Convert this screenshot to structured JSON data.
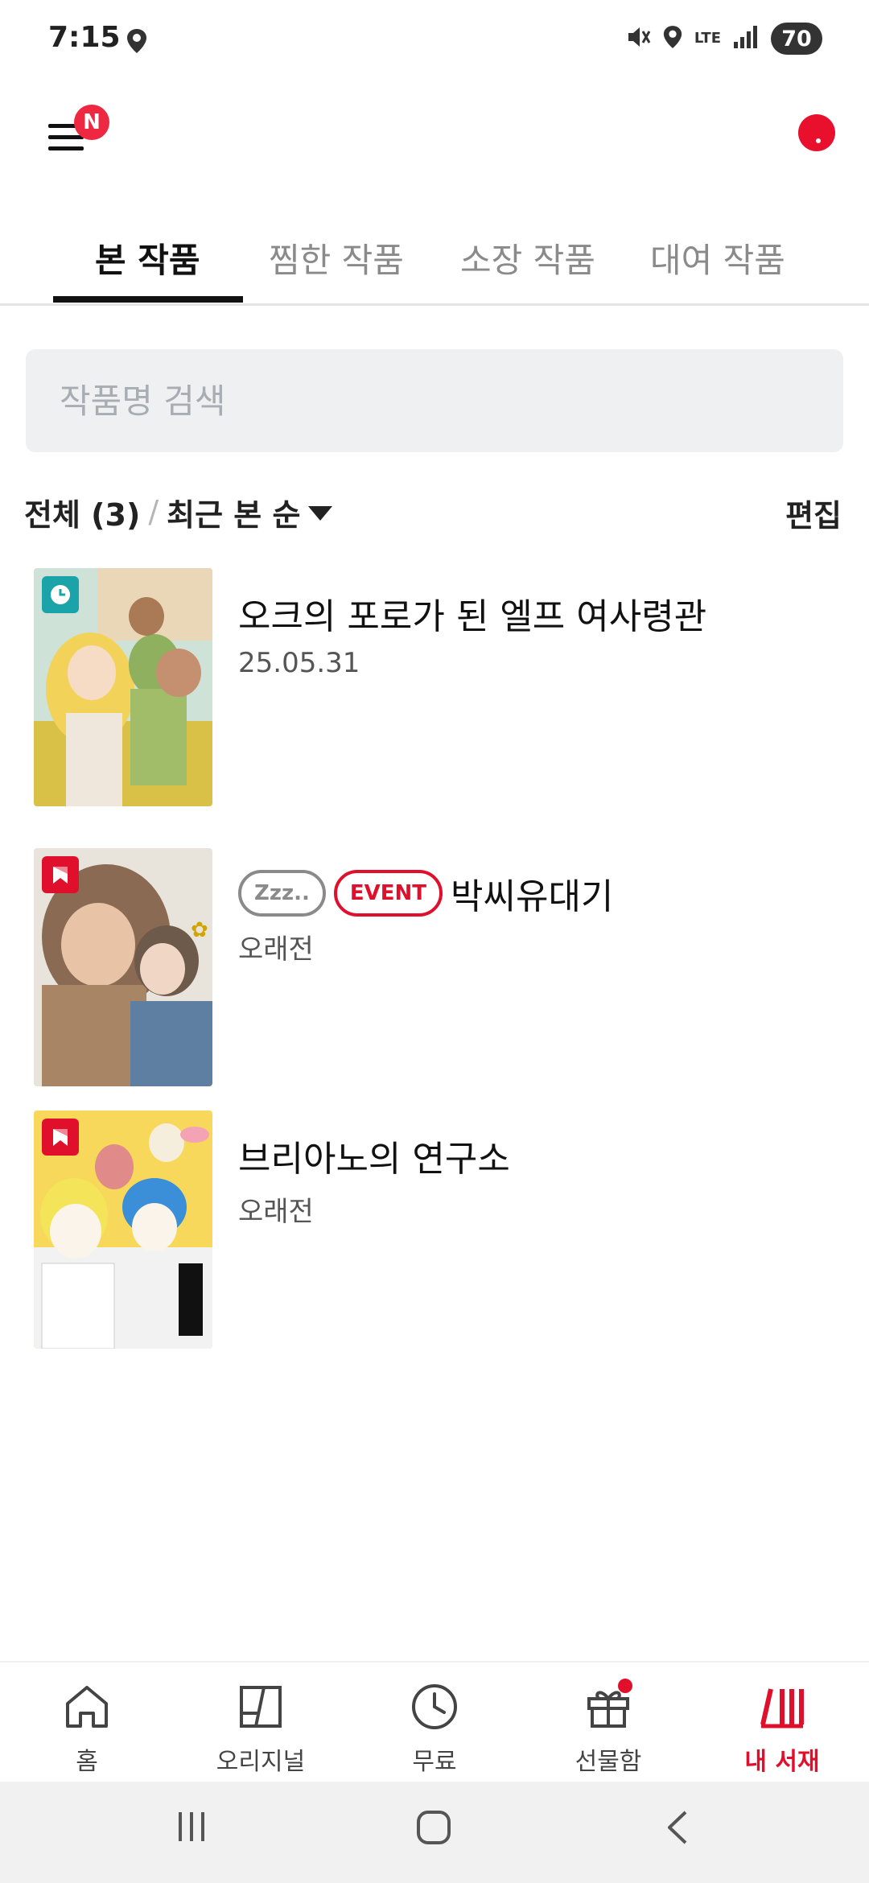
{
  "status_bar": {
    "time": "7:15",
    "network": "LTE",
    "battery": "70"
  },
  "header": {
    "new_badge": "N"
  },
  "tabs": [
    {
      "label": "본 작품",
      "active": true
    },
    {
      "label": "찜한 작품",
      "active": false
    },
    {
      "label": "소장 작품",
      "active": false
    },
    {
      "label": "대여 작품",
      "active": false
    }
  ],
  "search": {
    "placeholder": "작품명 검색",
    "value": ""
  },
  "filter": {
    "total_label": "전체 (3)",
    "separator": "/",
    "sort_label": "최근 본 순",
    "edit_label": "편집"
  },
  "works": [
    {
      "title": "오크의 포로가 된 엘프 여사령관",
      "subtitle": "25.05.31",
      "badge_icon": "clock-icon",
      "badge_color": "#1aa3a8",
      "tags": []
    },
    {
      "title": "박씨유대기",
      "subtitle": "오래전",
      "badge_icon": "bookmark-icon",
      "badge_color": "#e0102c",
      "tags": [
        "Zzz..",
        "EVENT"
      ]
    },
    {
      "title": "브리아노의 연구소",
      "subtitle": "오래전",
      "badge_icon": "bookmark-icon",
      "badge_color": "#e0102c",
      "tags": []
    }
  ],
  "bottom_nav": [
    {
      "label": "홈",
      "icon": "home-icon",
      "active": false
    },
    {
      "label": "오리지널",
      "icon": "original-icon",
      "active": false
    },
    {
      "label": "무료",
      "icon": "clock-icon",
      "active": false
    },
    {
      "label": "선물함",
      "icon": "gift-icon",
      "active": false,
      "has_dot": true
    },
    {
      "label": "내 서재",
      "icon": "library-icon",
      "active": true
    }
  ],
  "colors": {
    "accent": "#e0102c",
    "badge_new": "#ee2841",
    "search_bg": "#eef0f2"
  }
}
